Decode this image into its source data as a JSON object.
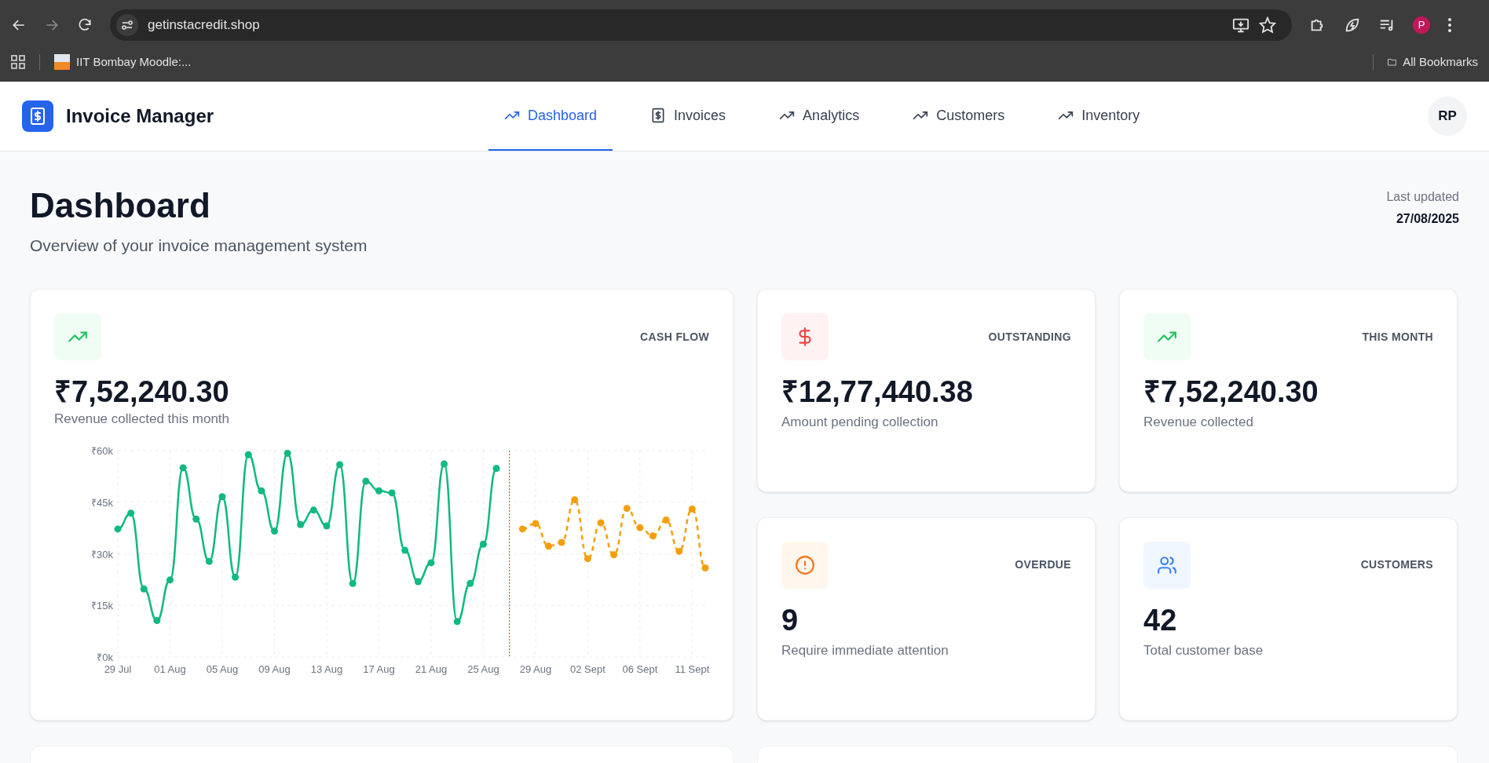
{
  "browser": {
    "url": "getinstacredit.shop",
    "bookmarks": [
      {
        "label": "IIT Bombay Moodle:..."
      }
    ],
    "all_bookmarks": "All Bookmarks",
    "profile": "P"
  },
  "app": {
    "name": "Invoice Manager",
    "avatar": "RP"
  },
  "nav": [
    {
      "label": "Dashboard",
      "kind": "trend",
      "selected": true
    },
    {
      "label": "Invoices",
      "kind": "receipt",
      "selected": false
    },
    {
      "label": "Analytics",
      "kind": "trend",
      "selected": false
    },
    {
      "label": "Customers",
      "kind": "trend",
      "selected": false
    },
    {
      "label": "Inventory",
      "kind": "trend",
      "selected": false
    }
  ],
  "header": {
    "title": "Dashboard",
    "subtitle": "Overview of your invoice management system",
    "updated_label": "Last updated",
    "updated_date": "27/08/2025"
  },
  "cash_flow": {
    "label": "CASH FLOW",
    "value": "₹7,52,240.30",
    "caption": "Revenue collected this month",
    "chart_data": {
      "type": "line",
      "categories": [
        "29 Jul",
        null,
        null,
        null,
        "01 Aug",
        null,
        null,
        null,
        "05 Aug",
        null,
        null,
        null,
        "09 Aug",
        null,
        null,
        null,
        "13 Aug",
        null,
        null,
        null,
        "17 Aug",
        null,
        null,
        null,
        "21 Aug",
        null,
        null,
        null,
        "25 Aug",
        null,
        null,
        null,
        "29 Aug",
        null,
        null,
        null,
        "02 Sept",
        null,
        null,
        null,
        "06 Sept",
        null,
        null,
        null,
        "11 Sept",
        null
      ],
      "series": [
        {
          "color": "#10b981",
          "marker": "circle",
          "line_style": "solid",
          "values": [
            37.2,
            41.8,
            19.8,
            10.6,
            22.4,
            55.0,
            40.1,
            27.8,
            46.6,
            23.2,
            58.8,
            48.3,
            36.6,
            59.2,
            38.5,
            42.7,
            38.1,
            55.9,
            21.4,
            51.1,
            48.3,
            47.7,
            31.0,
            21.9,
            27.4,
            56.1,
            10.3,
            21.4,
            32.8,
            54.8,
            null,
            null,
            null,
            null,
            null,
            null,
            null,
            null,
            null,
            null,
            null,
            null,
            null,
            null,
            null,
            null
          ]
        },
        {
          "color": "#f59e0b",
          "marker": "circle",
          "line_style": "dashed",
          "values": [
            null,
            null,
            null,
            null,
            null,
            null,
            null,
            null,
            null,
            null,
            null,
            null,
            null,
            null,
            null,
            null,
            null,
            null,
            null,
            null,
            null,
            null,
            null,
            null,
            null,
            null,
            null,
            null,
            null,
            null,
            null,
            37.2,
            38.8,
            32.2,
            33.3,
            45.7,
            28.6,
            39.0,
            29.7,
            43.2,
            37.6,
            35.2,
            39.8,
            30.7,
            43.0,
            25.9
          ]
        }
      ],
      "grid": true,
      "ylim": [
        0,
        60
      ],
      "yticks": [
        {
          "value": 0,
          "label": "₹0k"
        },
        {
          "value": 15,
          "label": "₹15k"
        },
        {
          "value": 30,
          "label": "₹30k"
        },
        {
          "value": 45,
          "label": "₹45k"
        },
        {
          "value": 60,
          "label": "₹60k"
        }
      ]
    }
  },
  "stats": [
    {
      "label": "OUTSTANDING",
      "value": "₹12,77,440.38",
      "caption": "Amount pending collection",
      "kind": "dollar",
      "color": "#ef4444"
    },
    {
      "label": "THIS MONTH",
      "value": "₹7,52,240.30",
      "caption": "Revenue collected",
      "kind": "trend",
      "color": "#22c55e"
    },
    {
      "label": "OVERDUE",
      "value": "9",
      "caption": "Require immediate attention",
      "kind": "alert",
      "color": "#f97316"
    },
    {
      "label": "CUSTOMERS",
      "value": "42",
      "caption": "Total customer base",
      "kind": "users",
      "color": "#3b82f6"
    }
  ]
}
